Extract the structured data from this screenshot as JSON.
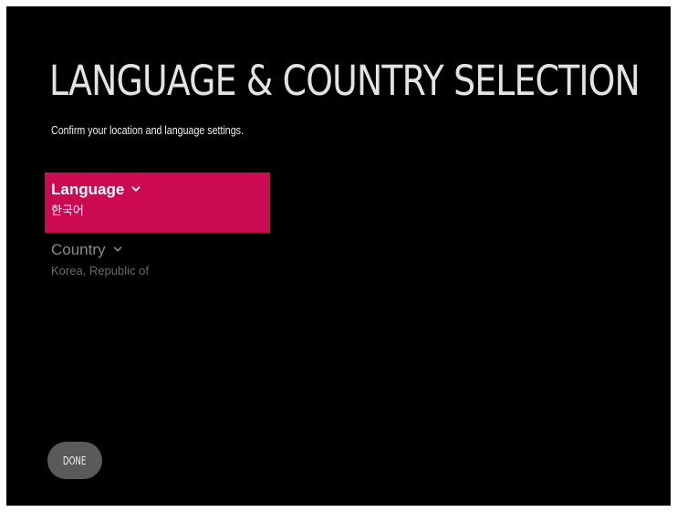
{
  "header": {
    "title": "LANGUAGE & COUNTRY SELECTION",
    "subtitle": "Confirm your location and language settings."
  },
  "settings": {
    "language": {
      "label": "Language",
      "value": "한국어",
      "icon": "chevron-down-icon",
      "focused": true
    },
    "country": {
      "label": "Country",
      "value": "Korea, Republic of",
      "icon": "chevron-down-icon",
      "focused": false
    }
  },
  "footer": {
    "done_label": "DONE"
  },
  "colors": {
    "background": "#000000",
    "focus_accent": "#cc0a52",
    "title_text": "#e3e3e3",
    "inactive_text": "#8a8a8a",
    "button_background": "#5a5a5a"
  }
}
